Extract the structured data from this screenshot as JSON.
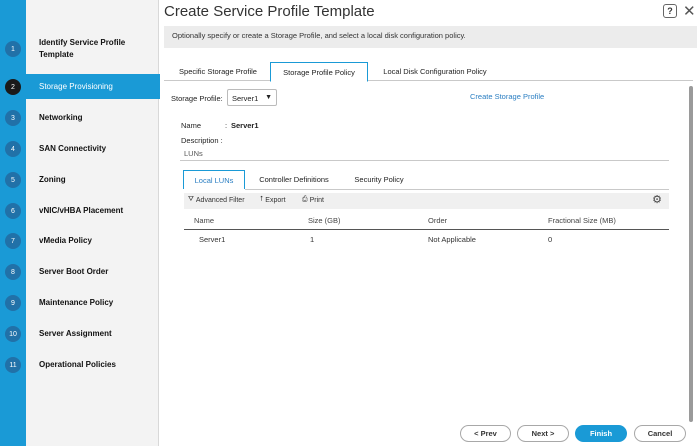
{
  "wizard": {
    "title": "Create Service Profile Template",
    "description": "Optionally specify or create a Storage Profile, and select a local disk configuration policy.",
    "help_label": "?",
    "close_label": "✕"
  },
  "steps": [
    {
      "num": "1",
      "label": "Identify Service Profile Template"
    },
    {
      "num": "2",
      "label": "Storage Provisioning"
    },
    {
      "num": "3",
      "label": "Networking"
    },
    {
      "num": "4",
      "label": "SAN Connectivity"
    },
    {
      "num": "5",
      "label": "Zoning"
    },
    {
      "num": "6",
      "label": "vNIC/vHBA Placement"
    },
    {
      "num": "7",
      "label": "vMedia Policy"
    },
    {
      "num": "8",
      "label": "Server Boot Order"
    },
    {
      "num": "9",
      "label": "Maintenance Policy"
    },
    {
      "num": "10",
      "label": "Server Assignment"
    },
    {
      "num": "11",
      "label": "Operational Policies"
    }
  ],
  "active_step": "2",
  "tabs": [
    "Specific Storage Profile",
    "Storage Profile Policy",
    "Local Disk Configuration Policy"
  ],
  "active_tab": "Storage Profile Policy",
  "storage_profile": {
    "label": "Storage Profile:",
    "selected": "Server1",
    "create_link": "Create Storage Profile"
  },
  "details": {
    "name_label": "Name",
    "colon": ":",
    "name_value": "Server1",
    "description_label": "Description :",
    "luns_label": "LUNs"
  },
  "subtabs": [
    "Local LUNs",
    "Controller Definitions",
    "Security Policy"
  ],
  "active_subtab": "Local LUNs",
  "toolbar": {
    "advanced_filter": "Advanced Filter",
    "export": "Export",
    "print": "Print"
  },
  "table": {
    "columns": [
      "Name",
      "Size (GB)",
      "Order",
      "Fractional Size (MB)"
    ],
    "rows": [
      [
        "Server1",
        "1",
        "Not Applicable",
        "0"
      ]
    ]
  },
  "footer": {
    "prev": "< Prev",
    "next": "Next >",
    "finish": "Finish",
    "cancel": "Cancel"
  },
  "colors": {
    "accent": "#1a9ad6",
    "step_circle": "#2171a8",
    "link": "#2a7ec2"
  }
}
